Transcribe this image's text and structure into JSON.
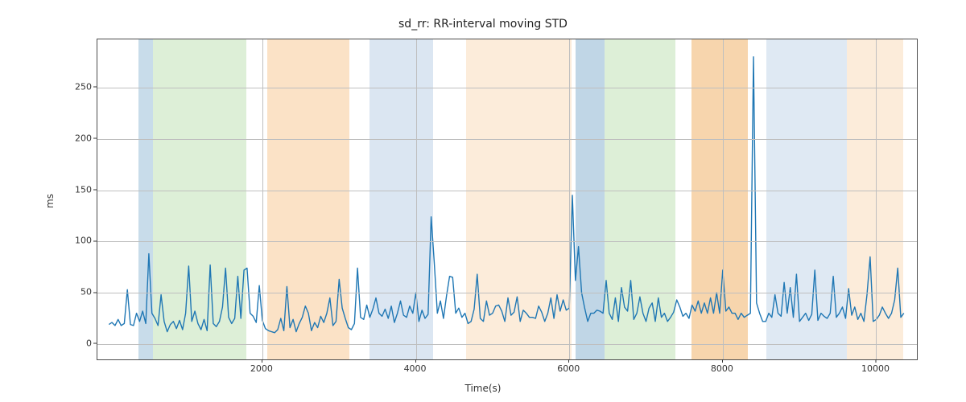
{
  "chart_data": {
    "type": "line",
    "title": "sd_rr: RR-interval moving STD",
    "xlabel": "Time(s)",
    "ylabel": "ms",
    "xlim": [
      -150,
      10530
    ],
    "ylim": [
      -15,
      297
    ],
    "yticks": [
      0,
      50,
      100,
      150,
      200,
      250
    ],
    "xticks": [
      2000,
      4000,
      6000,
      8000,
      10000
    ],
    "grid": true,
    "bands": [
      {
        "x0": 390,
        "x1": 570,
        "color": "#c8dcea"
      },
      {
        "x0": 570,
        "x1": 1790,
        "color": "#ddefd7"
      },
      {
        "x0": 2060,
        "x1": 3130,
        "color": "#fbe2c6"
      },
      {
        "x0": 3400,
        "x1": 4230,
        "color": "#dbe6f2"
      },
      {
        "x0": 4650,
        "x1": 6030,
        "color": "#fcecda"
      },
      {
        "x0": 6080,
        "x1": 6460,
        "color": "#c0d6e6"
      },
      {
        "x0": 6460,
        "x1": 7380,
        "color": "#ddefd7"
      },
      {
        "x0": 7590,
        "x1": 8330,
        "color": "#f7d5ad"
      },
      {
        "x0": 8570,
        "x1": 9620,
        "color": "#dfe9f3"
      },
      {
        "x0": 9620,
        "x1": 10350,
        "color": "#fcecda"
      }
    ],
    "series": [
      {
        "name": "sd_rr",
        "color": "#1f77b4",
        "x": [
          0,
          40,
          80,
          120,
          160,
          200,
          240,
          280,
          320,
          360,
          400,
          440,
          480,
          520,
          560,
          600,
          640,
          680,
          720,
          760,
          800,
          840,
          880,
          920,
          960,
          1000,
          1040,
          1080,
          1120,
          1160,
          1200,
          1240,
          1280,
          1320,
          1360,
          1400,
          1440,
          1480,
          1520,
          1560,
          1600,
          1640,
          1680,
          1720,
          1760,
          1800,
          1840,
          1880,
          1920,
          1960,
          2000,
          2040,
          2080,
          2120,
          2160,
          2200,
          2240,
          2280,
          2320,
          2360,
          2400,
          2440,
          2480,
          2520,
          2560,
          2600,
          2640,
          2680,
          2720,
          2760,
          2800,
          2840,
          2880,
          2920,
          2960,
          3000,
          3040,
          3080,
          3120,
          3160,
          3200,
          3240,
          3280,
          3320,
          3360,
          3400,
          3440,
          3480,
          3520,
          3560,
          3600,
          3640,
          3680,
          3720,
          3760,
          3800,
          3840,
          3880,
          3920,
          3960,
          4000,
          4040,
          4080,
          4120,
          4160,
          4200,
          4240,
          4280,
          4320,
          4360,
          4400,
          4440,
          4480,
          4520,
          4560,
          4600,
          4640,
          4680,
          4720,
          4760,
          4800,
          4840,
          4880,
          4920,
          4960,
          5000,
          5040,
          5080,
          5120,
          5160,
          5200,
          5240,
          5280,
          5320,
          5360,
          5400,
          5440,
          5480,
          5520,
          5560,
          5600,
          5640,
          5680,
          5720,
          5760,
          5800,
          5840,
          5880,
          5920,
          5960,
          6000,
          6040,
          6080,
          6120,
          6160,
          6200,
          6240,
          6280,
          6320,
          6360,
          6400,
          6440,
          6480,
          6520,
          6560,
          6600,
          6640,
          6680,
          6720,
          6760,
          6800,
          6840,
          6880,
          6920,
          6960,
          7000,
          7040,
          7080,
          7120,
          7160,
          7200,
          7240,
          7280,
          7320,
          7360,
          7400,
          7440,
          7480,
          7520,
          7560,
          7600,
          7640,
          7680,
          7720,
          7760,
          7800,
          7840,
          7880,
          7920,
          7960,
          8000,
          8040,
          8080,
          8120,
          8160,
          8200,
          8240,
          8280,
          8320,
          8360,
          8400,
          8440,
          8480,
          8520,
          8560,
          8600,
          8640,
          8680,
          8720,
          8760,
          8800,
          8840,
          8880,
          8920,
          8960,
          9000,
          9040,
          9080,
          9120,
          9160,
          9200,
          9240,
          9280,
          9320,
          9360,
          9400,
          9440,
          9480,
          9520,
          9560,
          9600,
          9640,
          9680,
          9720,
          9760,
          9800,
          9840,
          9880,
          9920,
          9960,
          10000,
          10040,
          10080,
          10120,
          10160,
          10200,
          10240,
          10280,
          10320,
          10360
        ],
        "y": [
          19,
          21,
          18,
          24,
          18,
          20,
          53,
          19,
          18,
          30,
          22,
          32,
          20,
          88,
          30,
          25,
          18,
          48,
          22,
          12,
          19,
          22,
          15,
          23,
          14,
          30,
          76,
          22,
          32,
          20,
          14,
          24,
          13,
          77,
          20,
          17,
          22,
          36,
          74,
          26,
          20,
          25,
          66,
          25,
          72,
          74,
          30,
          27,
          21,
          57,
          23,
          15,
          13,
          12,
          11,
          14,
          25,
          13,
          56,
          16,
          24,
          12,
          20,
          26,
          37,
          30,
          13,
          21,
          16,
          27,
          21,
          30,
          45,
          18,
          22,
          63,
          35,
          25,
          16,
          14,
          20,
          74,
          26,
          24,
          38,
          26,
          34,
          45,
          30,
          27,
          34,
          25,
          37,
          21,
          30,
          42,
          28,
          26,
          37,
          30,
          50,
          22,
          33,
          25,
          29,
          124,
          80,
          30,
          42,
          25,
          47,
          66,
          65,
          30,
          35,
          26,
          30,
          20,
          22,
          34,
          68,
          25,
          22,
          42,
          28,
          30,
          37,
          38,
          32,
          22,
          45,
          28,
          31,
          46,
          22,
          33,
          30,
          26,
          26,
          25,
          37,
          31,
          22,
          30,
          45,
          25,
          48,
          32,
          43,
          33,
          35,
          145,
          62,
          95,
          50,
          35,
          22,
          30,
          30,
          33,
          32,
          30,
          62,
          30,
          24,
          45,
          22,
          55,
          36,
          32,
          62,
          24,
          30,
          46,
          30,
          22,
          35,
          40,
          22,
          45,
          26,
          30,
          22,
          26,
          31,
          43,
          36,
          27,
          30,
          25,
          38,
          32,
          42,
          30,
          40,
          30,
          45,
          30,
          50,
          30,
          72,
          32,
          36,
          30,
          30,
          24,
          30,
          26,
          28,
          30,
          280,
          40,
          30,
          22,
          22,
          30,
          26,
          48,
          30,
          27,
          60,
          30,
          55,
          26,
          68,
          22,
          26,
          30,
          23,
          29,
          72,
          23,
          30,
          27,
          25,
          30,
          66,
          26,
          30,
          36,
          25,
          54,
          28,
          36,
          24,
          30,
          22,
          48,
          85,
          22,
          24,
          28,
          36,
          30,
          25,
          30,
          43,
          74,
          26,
          30
        ]
      }
    ]
  }
}
